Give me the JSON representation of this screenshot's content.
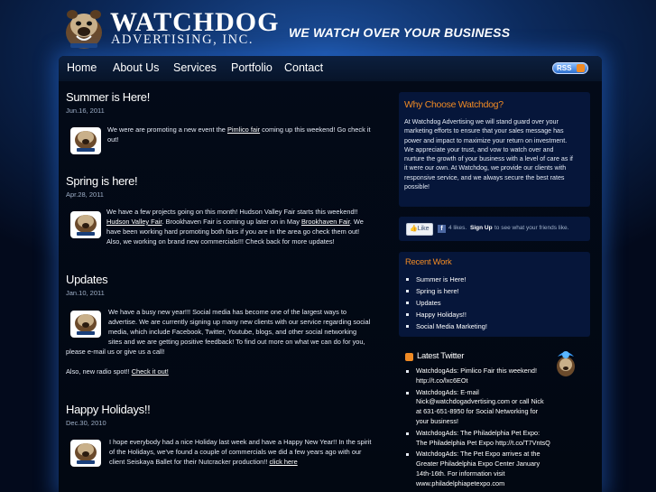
{
  "header": {
    "logo_name": "WATCHDOG",
    "logo_sub": "ADVERTISING, INC.",
    "tagline": "WE WATCH OVER YOUR BUSINESS"
  },
  "nav": {
    "items": [
      "Home",
      "About Us",
      "Services",
      "Portfolio",
      "Contact"
    ],
    "rss_label": "RSS"
  },
  "posts": [
    {
      "title": "Summer is Here!",
      "date": "Jun.16, 2011",
      "lines": [
        [
          "We were are promoting a new event  the ",
          "Pimlico fair",
          " coming up this weekend! Go check it"
        ],
        [
          "out!",
          "",
          ""
        ]
      ]
    },
    {
      "title": "Spring is here!",
      "date": "Apr.28, 2011",
      "lines": [
        [
          "We have a few projects going on this month! Hudson Valley Fair starts this weekend!!",
          "",
          ""
        ],
        [
          "",
          "Hudson Valley Fair",
          ".   Brookhaven Fair is coming up later on in May "
        ],
        [
          "Brookhaven Fair",
          ". We",
          ""
        ],
        [
          "have been working hard promoting both fairs if you are in the area go check them out!",
          "",
          ""
        ],
        [
          "Also, we working on brand new commercials!!! Check back for more updates!",
          "",
          ""
        ]
      ]
    },
    {
      "title": "Updates",
      "date": "Jan.10, 2011",
      "lines": [
        "We have a busy new year!!! Social media has become one of the largest ways to",
        "advertise. We are currently signing up many new clients with our service regarding social",
        "media, which include Facebook, Twitter, Youtube, blogs, and other social networking",
        "sites and we are getting positive feedback!  To find out more on what we can do for you,",
        "please e-mail us or give us a call!"
      ],
      "after_text": "Also, new radio spot!! ",
      "after_link": "Check it out!"
    },
    {
      "title": "Happy Holidays!!",
      "date": "Dec.30, 2010",
      "lines": [
        "I hope everybody had a nice Holiday last week and have a Happy New Year!! In the spirit",
        "of the Holidays, we've found a couple of commercials we did a few years ago with our",
        "client Seiskaya Ballet for their Nutcracker production!!  "
      ],
      "link": "click here"
    }
  ],
  "sidebar": {
    "why": {
      "title": "Why Choose Watchdog?",
      "lines": [
        "At Watchdog Advertising we will stand guard over your",
        "marketing efforts to ensure that your sales message has",
        "power and impact to maximize your return on investment.",
        "We appreciate your trust, and vow to watch over and",
        "nurture the growth of your business with a level of care as if",
        "it were our own. At Watchdog, we provide our clients with",
        "responsive service, and we always secure the best rates",
        "possible!"
      ]
    },
    "facebook": {
      "like_label": "Like",
      "fb_glyph": "f",
      "count_text": "4 likes.",
      "signup_text": "Sign Up",
      "rest_text": " to see what your friends like."
    },
    "recent": {
      "title": "Recent Work",
      "items": [
        "Summer is Here!",
        "Spring is here!",
        "Updates",
        "Happy Holidays!!",
        "Social Media Marketing!"
      ]
    },
    "twitter": {
      "title": "Latest Twitter",
      "tweets": [
        [
          "WatchdogAds: Pimlico Fair this weekend!",
          "http://t.co/lxc6EOt"
        ],
        [
          "WatchdogAds: E-mail",
          "Nick@watchdogadvertising.com or call Nick",
          "at 631-651-8950 for Social Networking for",
          "your business!"
        ],
        [
          "WatchdogAds: The Philadelphia Pet Expo:",
          "The Philadelphia Pet Expo http://t.co/T7VntsQ"
        ],
        [
          "WatchdogAds: The Pet Expo arrives at the",
          "Greater Philadelphia Expo Center January",
          "14th-16th. For information visit",
          "www.philadelphiapetexpo.com"
        ]
      ]
    }
  },
  "colors": {
    "accent_orange": "#f08a24",
    "background_blue": "#0c2a5c",
    "panel_blue": "#06163a"
  }
}
